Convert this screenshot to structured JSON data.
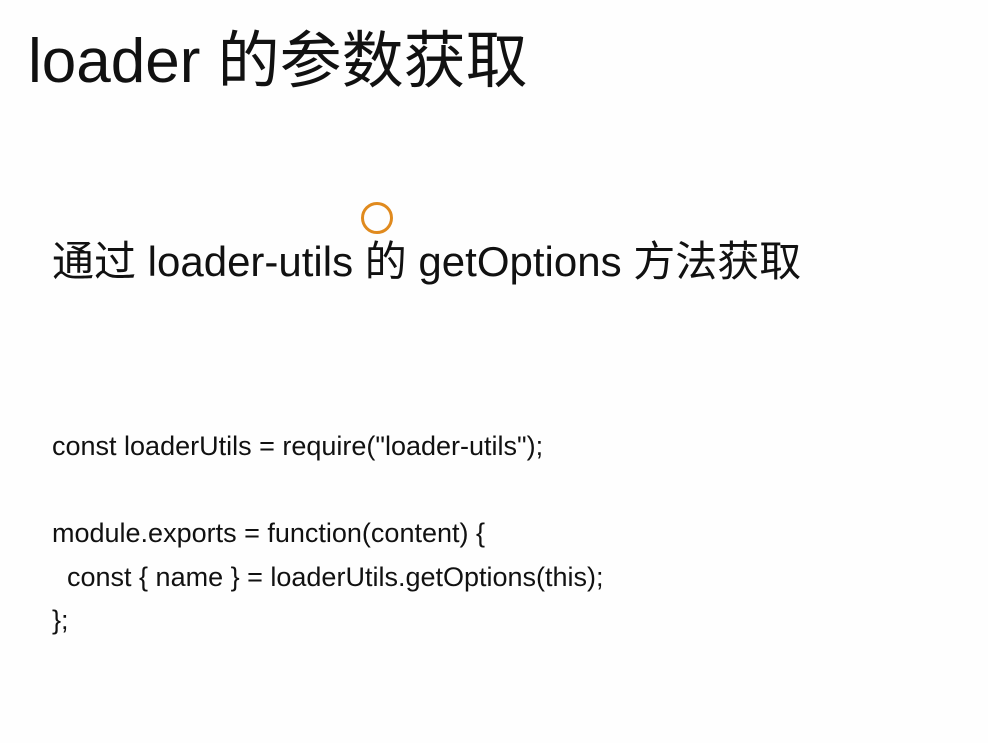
{
  "slide": {
    "title": "loader 的参数获取",
    "subtitle": "通过 loader-utils 的 getOptions 方法获取",
    "code_lines": [
      "const loaderUtils = require(\"loader-utils\");",
      "",
      "module.exports = function(content) {",
      "  const { name } = loaderUtils.getOptions(this);",
      "};"
    ]
  },
  "colors": {
    "cursor": "#e08a1e"
  }
}
